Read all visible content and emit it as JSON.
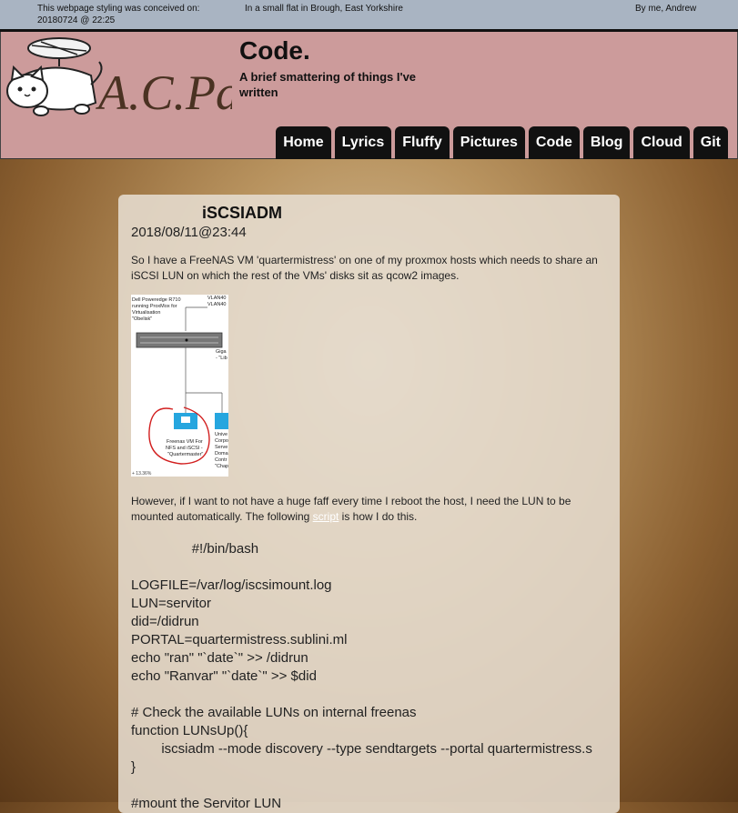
{
  "topbar": {
    "conceived_label": "This webpage styling was conceived on:",
    "conceived_date": "20180724 @ 22:25",
    "location": "In a small flat in Brough, East Yorkshire",
    "author": "By me, Andrew"
  },
  "header": {
    "logo_text": "A.C.Patt",
    "title": "Code.",
    "subtitle": "A brief smattering of things I've written"
  },
  "nav": [
    "Home",
    "Lyrics",
    "Fluffy",
    "Pictures",
    "Code",
    "Blog",
    "Cloud",
    "Git"
  ],
  "post": {
    "title": "iSCSIADM",
    "date": "2018/08/11@23:44",
    "intro": "So I have a FreeNAS VM 'quartermistress' on one of my proxmox hosts which needs to share an iSCSI LUN on which the rest of the VMs' disks sit as qcow2 images.",
    "outro_before": "However, if I want to not have a huge faff every time I reboot the host, I need the LUN to be mounted automatically. The following ",
    "outro_link": "script",
    "outro_after": " is how I do this.",
    "diagram": {
      "server_label": "Dell Poweredge R710 running ProxMox for Virtualisation \"Obelisk\"",
      "vlan1": "VLAN40",
      "vlan2": "VLAN40",
      "giga": "Giga - \"Lib",
      "vm_label": "Freenas VM For NFS and iSCSI - \"Quartermaster\"",
      "other_label": "Unive Corpo Serve Doma Contr \"Chap",
      "zoom": "+ 13.36%"
    },
    "code": "\t\t#!/bin/bash\n\nLOGFILE=/var/log/iscsimount.log\nLUN=servitor\ndid=/didrun\nPORTAL=quartermistress.sublini.ml\necho \"ran\" \"`date`\" >> /didrun\necho \"Ranvar\" \"`date`\" >> $did\n\n# Check the available LUNs on internal freenas\nfunction LUNsUp(){\n\tiscsiadm --mode discovery --type sendtargets --portal quartermistress.s\n}\n\n#mount the Servitor LUN"
  }
}
